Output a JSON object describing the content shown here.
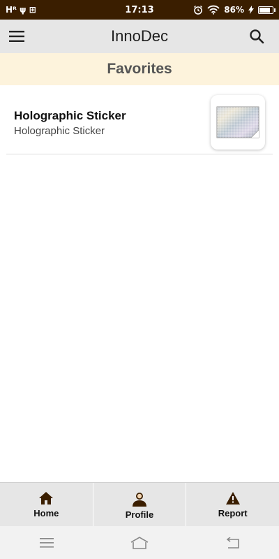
{
  "status_bar": {
    "left": "Hᴿ ψ ⊞",
    "time": "17:13",
    "battery_percent": "86%",
    "battery_level": 0.86
  },
  "app_bar": {
    "title": "InnoDec"
  },
  "section": {
    "title": "Favorites"
  },
  "favorites": [
    {
      "title": "Holographic Sticker",
      "subtitle": "Holographic Sticker"
    }
  ],
  "bottom_nav": {
    "home": "Home",
    "profile": "Profile",
    "report": "Report"
  },
  "colors": {
    "status_bar": "#3a1e00",
    "icon_brown": "#3a1e00",
    "section_bg": "#fdf3dc"
  }
}
